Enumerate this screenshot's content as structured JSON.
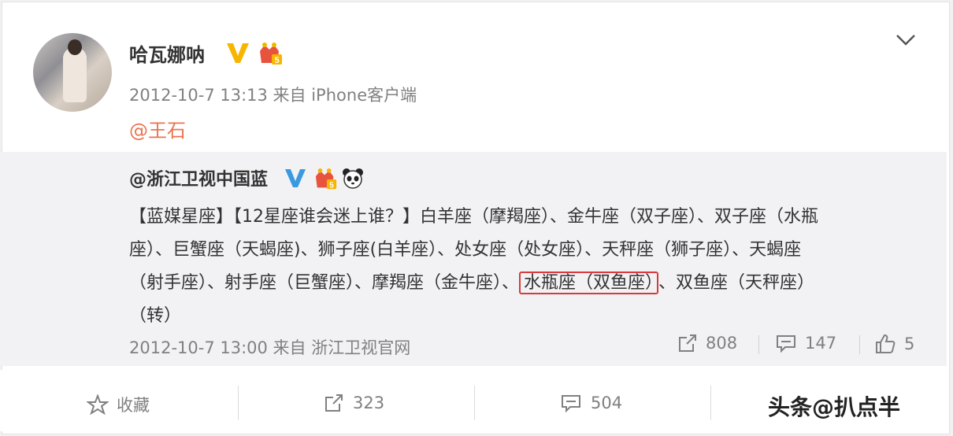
{
  "post": {
    "author": "哈瓦娜呐",
    "meta": "2012-10-7 13:13 来自 iPhone客户端",
    "mention": "@王石"
  },
  "repost": {
    "author": "@浙江卫视中国蓝",
    "text_lines": [
      "【蓝媒星座】【12星座谁会迷上谁？】白羊座（摩羯座）、金牛座（双子座）、双子座（水瓶",
      "座）、巨蟹座（天蝎座)、狮子座(白羊座）、处女座（处女座）、天秤座（狮子座）、天蝎座",
      "（射手座）、射手座（巨蟹座）、摩羯座（金牛座）、",
      "（转）"
    ],
    "highlight": "水瓶座（双鱼座）",
    "after_highlight": "、双鱼座（天秤座）",
    "meta": "2012-10-7 13:00 来自 浙江卫视官网",
    "reposts": "808",
    "comments": "147",
    "likes": "5"
  },
  "actions": {
    "favorite": "收藏",
    "reposts": "323",
    "comments": "504"
  },
  "watermark": "头条@扒点半",
  "colors": {
    "mention": "#eb7350",
    "highlight_border": "#d83a3a",
    "verified": "#f7b500"
  }
}
